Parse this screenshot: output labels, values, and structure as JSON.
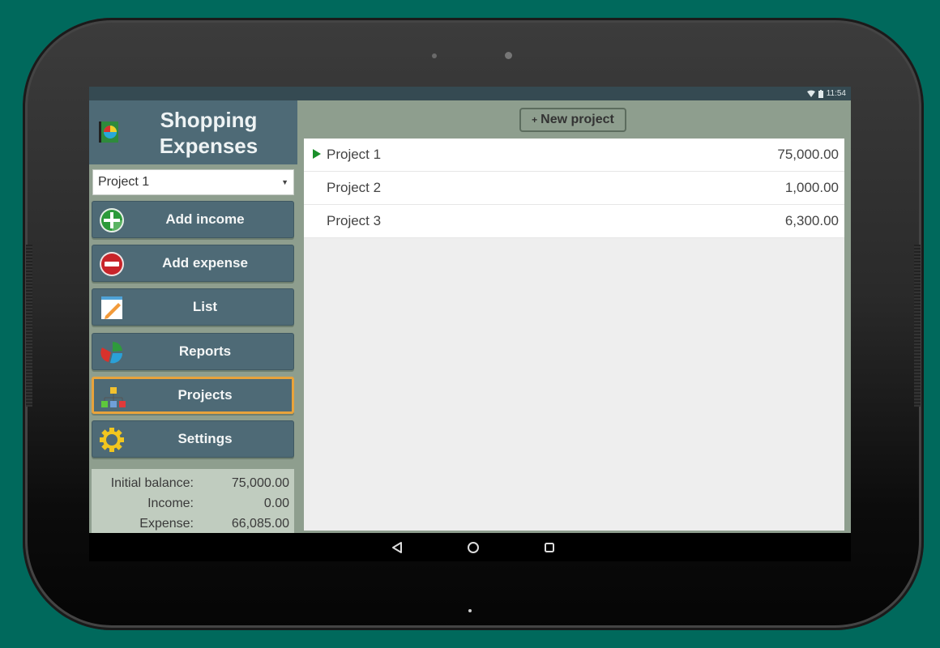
{
  "status_bar": {
    "wifi_icon": "wifi-icon",
    "battery_icon": "battery-icon",
    "time": "11:54"
  },
  "app": {
    "title_line1": "Shopping",
    "title_line2": "Expenses",
    "logo_icon": "pie-chart-book-icon"
  },
  "project_selector": {
    "selected": "Project 1"
  },
  "nav": {
    "items": [
      {
        "label": "Add income",
        "icon": "plus-circle-green-icon",
        "active": false
      },
      {
        "label": "Add expense",
        "icon": "minus-circle-red-icon",
        "active": false
      },
      {
        "label": "List",
        "icon": "notepad-pencil-icon",
        "active": false
      },
      {
        "label": "Reports",
        "icon": "pie-chart-icon",
        "active": false
      },
      {
        "label": "Projects",
        "icon": "hierarchy-icon",
        "active": true
      },
      {
        "label": "Settings",
        "icon": "gear-icon",
        "active": false
      }
    ]
  },
  "summary": {
    "initial_balance_label": "Initial balance:",
    "initial_balance_value": "75,000.00",
    "income_label": "Income:",
    "income_value": "0.00",
    "expense_label": "Expense:",
    "expense_value": "66,085.00"
  },
  "toolbar": {
    "new_project_prefix": "+",
    "new_project_label": "New project"
  },
  "projects": [
    {
      "name": "Project 1",
      "amount": "75,000.00",
      "selected": true
    },
    {
      "name": "Project 2",
      "amount": "1,000.00",
      "selected": false
    },
    {
      "name": "Project 3",
      "amount": "6,300.00",
      "selected": false
    }
  ],
  "system_nav": {
    "back": "back-icon",
    "home": "home-icon",
    "recents": "recents-icon"
  },
  "colors": {
    "background": "#00695c",
    "header": "#4e6a76",
    "panel": "#8e9e8e",
    "active_border": "#e8a33c",
    "selected_arrow": "#1a8f2a"
  }
}
